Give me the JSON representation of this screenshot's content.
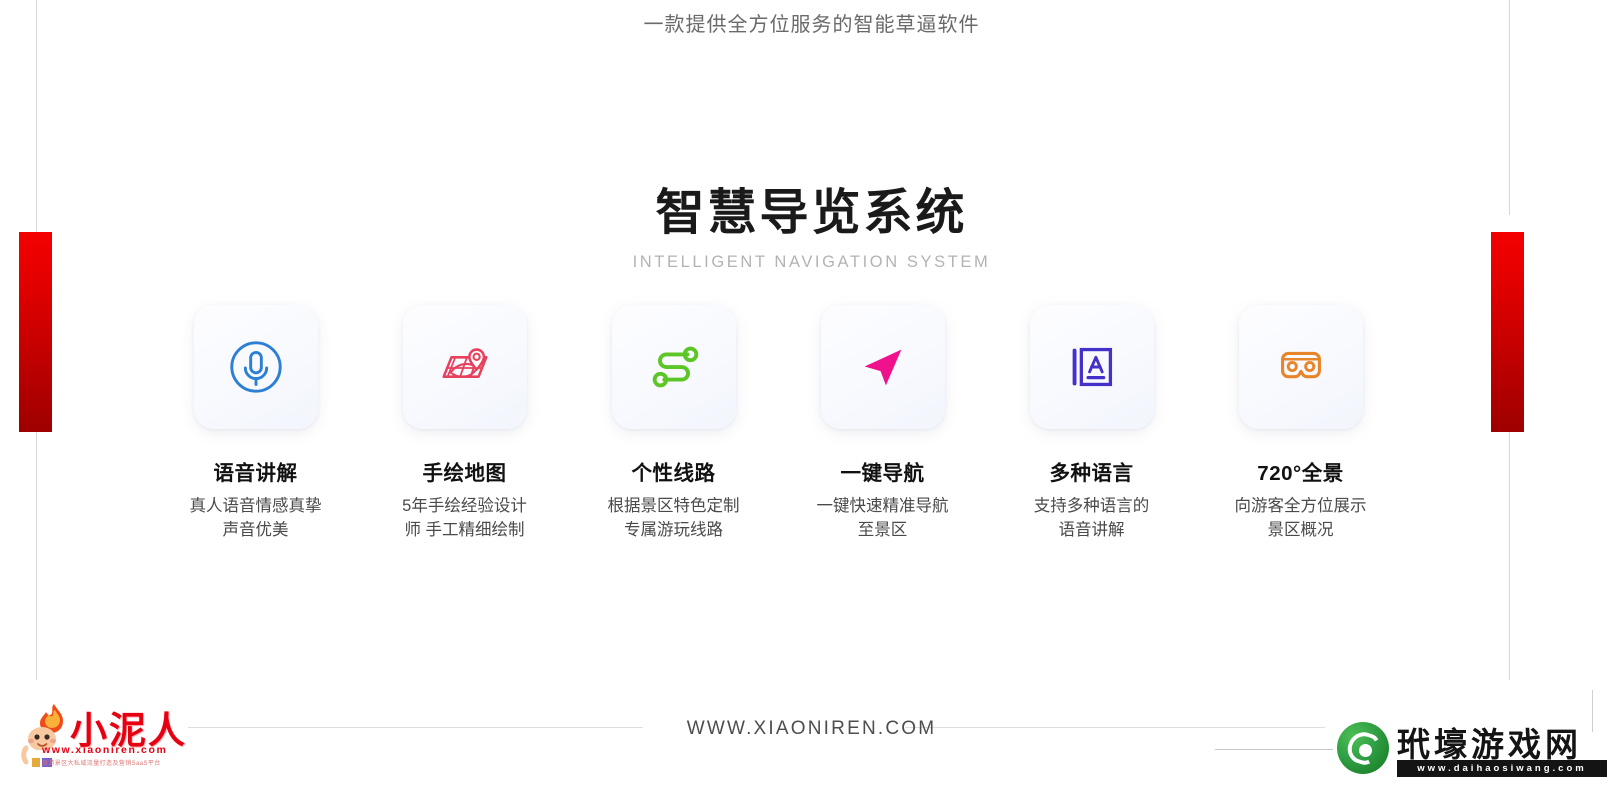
{
  "tagline": "一款提供全方位服务的智能草逼软件",
  "heading": {
    "title": "智慧导览系统",
    "subtitle": "INTELLIGENT NAVIGATION SYSTEM"
  },
  "features": [
    {
      "icon": "microphone-icon",
      "color": "#2b7fd4",
      "title": "语音讲解",
      "desc": "真人语音情感真挚\n声音优美"
    },
    {
      "icon": "hand-drawn-map-icon",
      "color": "#e8415e",
      "title": "手绘地图",
      "desc": "5年手绘经验设计\n师 手工精细绘制"
    },
    {
      "icon": "route-icon",
      "color": "#5dc627",
      "title": "个性线路",
      "desc": "根据景区特色定制\n专属游玩线路"
    },
    {
      "icon": "navigation-arrow-icon",
      "color": "#f0128c",
      "title": "一键导航",
      "desc": "一键快速精准导航\n至景区"
    },
    {
      "icon": "language-book-icon",
      "color": "#4331c9",
      "title": "多种语言",
      "desc": "支持多种语言的\n语音讲解"
    },
    {
      "icon": "vr-goggles-icon",
      "color": "#e8852a",
      "title": "720°全景",
      "desc": "向游客全方位展示\n景区概况"
    }
  ],
  "footer": {
    "url": "WWW.XIAONIREN.COM"
  },
  "logo_xiaoniren": {
    "name": "小泥人",
    "url": "www.xiaoniren.com",
    "slogan": "旅游景区大私域流量打造及营销SaaS平台"
  },
  "logo_daihaosiwang": {
    "name": "玳壕游戏网",
    "url": "www.daihaosiwang.com"
  },
  "colors": {
    "sidebar_red": "#e00000",
    "heading_dark": "#1a1a1a",
    "subtitle_gray": "#b3b3b3"
  }
}
